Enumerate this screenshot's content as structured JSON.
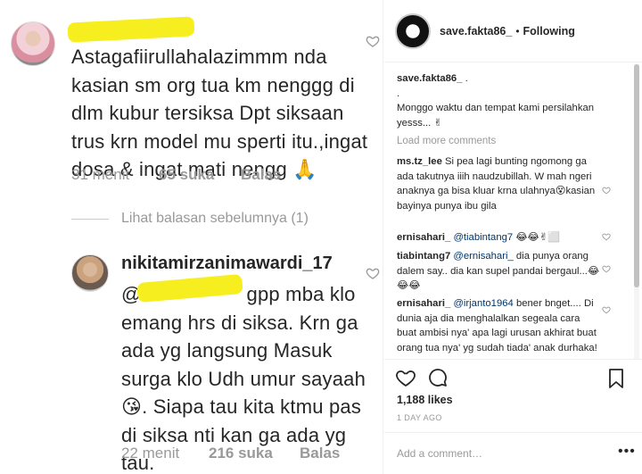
{
  "left_panel": {
    "comment1": {
      "text": "Astagafiirullahalazimmm nda kasian sm org tua km nenggg di dlm kubur tersiksa Dpt siksaan trus krn model mu sperti itu.,ingat dosa & ingat mati nengg 🙏",
      "time": "31 menit",
      "likes": "65 suka",
      "reply": "Balas"
    },
    "view_previous": "Lihat balasan sebelumnya (1)",
    "comment2": {
      "username": "nikitamirzanimawardi_17",
      "text": "gpp mba klo emang hrs di siksa. Krn ga ada yg langsung Masuk surga klo Udh umur sayaah 😘. Siapa tau kita ktmu pas di siksa nti kan ga ada yg tau.",
      "time": "22 menit",
      "likes": "216 suka",
      "reply": "Balas"
    }
  },
  "header": {
    "username": "save.fakta86_",
    "separator": "•",
    "follow_status": "Following"
  },
  "comments": [
    {
      "user": "save.fakta86_",
      "text": " .\n.\nMonggo waktu dan tempat kami persilahkan yesss... ✌"
    },
    {
      "user": "ms.tz_lee",
      "text": " Si pea lagi bunting ngomong ga ada takutnya iiih naudzubillah. W mah ngeri anaknya ga bisa kluar krna ulahnya😵kasian bayinya punya ibu gila"
    },
    {
      "user": "ernisahari_",
      "mention": "@tiabintang7",
      "text": " 😂😂✌⬜"
    },
    {
      "user": "tiabintang7",
      "mention": "@ernisahari_",
      "text": " dia punya orang dalem say.. dia kan supel pandai bergaul...😂😂😂"
    },
    {
      "user": "ernisahari_",
      "mention": "@irjanto1964",
      "text": " bener bnget.... Di dunia aja dia menghalalkan segeala cara buat ambisi nya' apa lagi urusan akhirat buat orang tua nya' yg sudah tiada' anak durhaka! Ddhal"
    }
  ],
  "load_more": "Load more comments",
  "post": {
    "likes": "1,188 likes",
    "time": "1 DAY AGO",
    "add_comment_placeholder": "Add a comment…",
    "more_label": "•••"
  },
  "colors": {
    "redaction": "#f6ee1e",
    "muted": "#999999",
    "text": "#262626",
    "mention": "#003569"
  }
}
